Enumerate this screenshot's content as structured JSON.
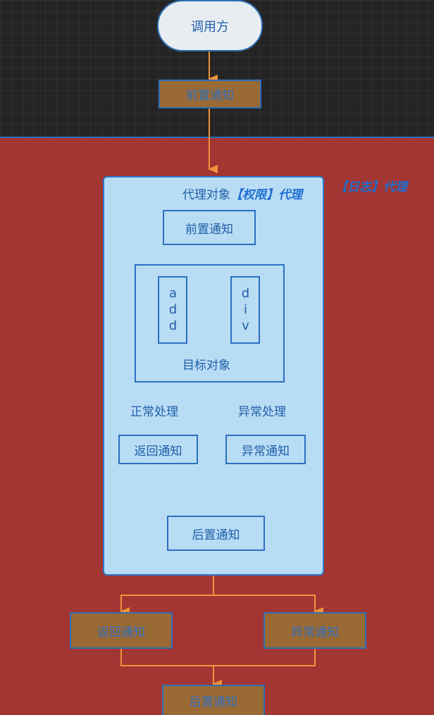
{
  "caller": "调用方",
  "outer": {
    "before": "前置通知",
    "return": "返回通知",
    "exception": "异常通知",
    "after": "后置通知"
  },
  "proxy_title": {
    "prefix": "代理对象",
    "permission": "【权限】代理",
    "log": "【日志】代理"
  },
  "inner": {
    "before": "前置通知",
    "method_add": "add",
    "method_div": "div",
    "target": "目标对象",
    "normal": "正常处理",
    "abnormal": "异常处理",
    "return": "返回通知",
    "exception": "异常通知",
    "after": "后置通知"
  },
  "colors": {
    "background": "#a33533",
    "top_band": "#242424",
    "panel": "#b9dcf5",
    "brown": "#9a6a35",
    "arrow": "#f0943a",
    "border_blue": "#2d6fb5"
  }
}
